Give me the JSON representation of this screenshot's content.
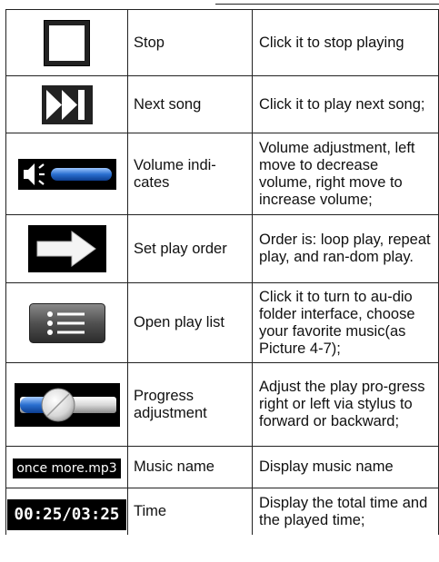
{
  "rows": [
    {
      "icon": "stop-icon",
      "name": "Stop",
      "desc": "Click it to stop playing"
    },
    {
      "icon": "next-song-icon",
      "name": "Next song",
      "desc": "Click it to play next song;"
    },
    {
      "icon": "volume-icon",
      "name": "Volume indi-cates",
      "desc": "Volume adjustment, left move to decrease volume, right move to increase volume;"
    },
    {
      "icon": "arrow-right-icon",
      "name": "Set play order",
      "desc": "Order is: loop play, repeat play, and ran-dom play."
    },
    {
      "icon": "list-icon",
      "name": "Open play list",
      "desc": "Click it to turn to au-dio folder interface, choose your favorite music(as Picture 4-7);"
    },
    {
      "icon": "progress-slider-icon",
      "name": "Progress adjustment",
      "desc": "Adjust the play pro-gress right or left via stylus to forward or backward;"
    },
    {
      "icon": "track-name-display",
      "name": "Music name",
      "desc": "Display music name",
      "badge": "once more.mp3"
    },
    {
      "icon": "time-display",
      "name": "Time",
      "desc": "Display the total time and the played time;",
      "badge": "00:25/03:25"
    }
  ],
  "colors": {
    "icon_black": "#000000",
    "accent_blue": "#2a6fd0",
    "border": "#222222"
  }
}
